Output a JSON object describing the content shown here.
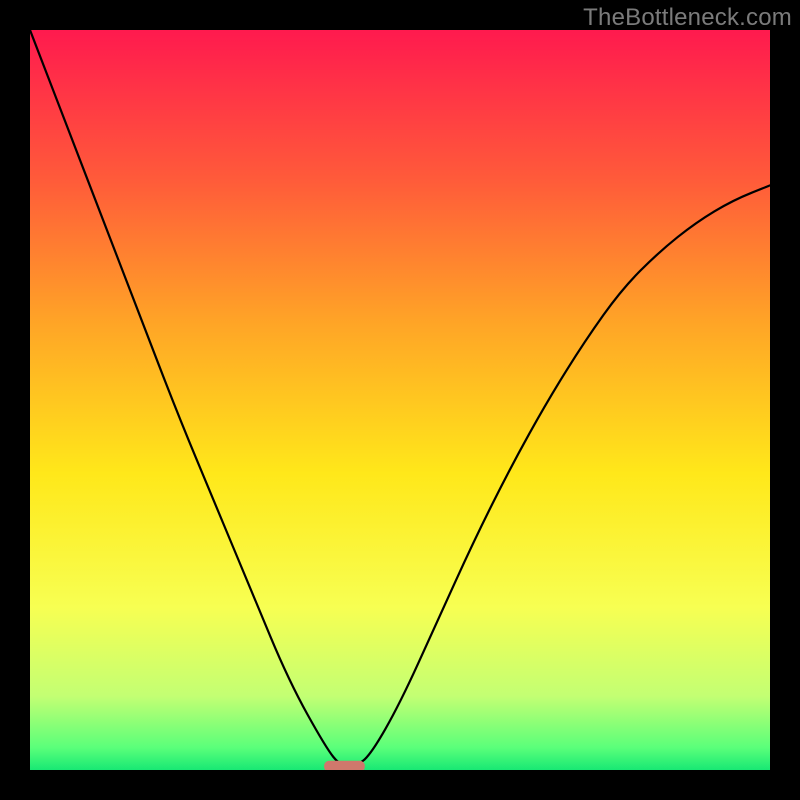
{
  "watermark": "TheBottleneck.com",
  "chart_data": {
    "type": "line",
    "title": "",
    "xlabel": "",
    "ylabel": "",
    "xlim": [
      0,
      1
    ],
    "ylim": [
      0,
      1
    ],
    "grid": false,
    "legend": false,
    "background_gradient_stops": [
      {
        "offset": 0.0,
        "color": "#ff1a4e"
      },
      {
        "offset": 0.2,
        "color": "#ff5a3a"
      },
      {
        "offset": 0.4,
        "color": "#ffa626"
      },
      {
        "offset": 0.6,
        "color": "#ffe81a"
      },
      {
        "offset": 0.78,
        "color": "#f7ff52"
      },
      {
        "offset": 0.9,
        "color": "#c3ff73"
      },
      {
        "offset": 0.97,
        "color": "#5aff7a"
      },
      {
        "offset": 1.0,
        "color": "#18e874"
      }
    ],
    "x_curve": [
      0.0,
      0.05,
      0.1,
      0.15,
      0.2,
      0.25,
      0.3,
      0.35,
      0.4,
      0.42,
      0.44,
      0.46,
      0.5,
      0.55,
      0.6,
      0.65,
      0.7,
      0.75,
      0.8,
      0.85,
      0.9,
      0.95,
      1.0
    ],
    "y_curve": [
      1.0,
      0.87,
      0.74,
      0.61,
      0.48,
      0.36,
      0.24,
      0.12,
      0.03,
      0.005,
      0.005,
      0.02,
      0.09,
      0.2,
      0.31,
      0.41,
      0.5,
      0.58,
      0.65,
      0.7,
      0.74,
      0.77,
      0.79
    ],
    "dip_marker": {
      "x_center": 0.425,
      "y_center": 0.005,
      "width": 0.055,
      "height": 0.015,
      "color": "#d0786c"
    }
  }
}
